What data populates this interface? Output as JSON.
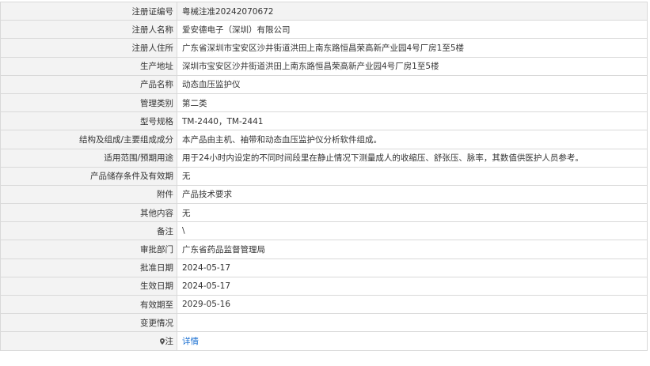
{
  "rows": [
    {
      "label": "注册证编号",
      "value": "粤械注准20242070672"
    },
    {
      "label": "注册人名称",
      "value": "爱安德电子（深圳）有限公司"
    },
    {
      "label": "注册人住所",
      "value": "广东省深圳市宝安区沙井街道洪田上南东路恒昌荣高新产业园4号厂房1至5楼"
    },
    {
      "label": "生产地址",
      "value": "深圳市宝安区沙井街道洪田上南东路恒昌荣高新产业园4号厂房1至5楼"
    },
    {
      "label": "产品名称",
      "value": "动态血压监护仪"
    },
    {
      "label": "管理类别",
      "value": "第二类"
    },
    {
      "label": "型号规格",
      "value": "TM-2440，TM-2441"
    },
    {
      "label": "结构及组成/主要组成成分",
      "value": "本产品由主机、袖带和动态血压监护仪分析软件组成。"
    },
    {
      "label": "适用范围/预期用途",
      "value": "用于24小时内设定的不同时间段里在静止情况下测量成人的收缩压、舒张压、脉率，其数值供医护人员参考。"
    },
    {
      "label": "产品储存条件及有效期",
      "value": "无"
    },
    {
      "label": "附件",
      "value": "产品技术要求"
    },
    {
      "label": "其他内容",
      "value": "无"
    },
    {
      "label": "备注",
      "value": "\\"
    },
    {
      "label": "审批部门",
      "value": "广东省药品监督管理局"
    },
    {
      "label": "批准日期",
      "value": "2024-05-17"
    },
    {
      "label": "生效日期",
      "value": "2024-05-17"
    },
    {
      "label": "有效期至",
      "value": "2029-05-16"
    },
    {
      "label": "变更情况",
      "value": ""
    }
  ],
  "note_row": {
    "label": "注",
    "icon": "location-pin-icon",
    "link_text": "详情"
  }
}
